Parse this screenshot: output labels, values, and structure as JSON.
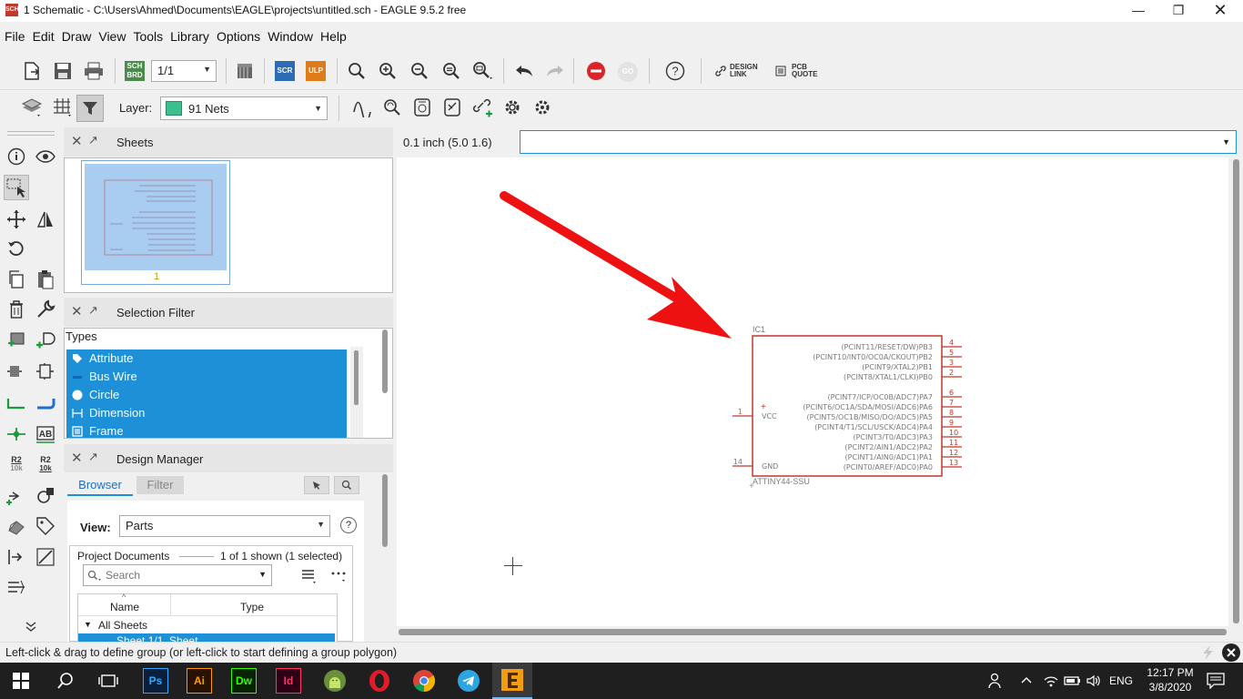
{
  "window": {
    "app_icon_text": "SCH",
    "title": "1 Schematic - C:\\Users\\Ahmed\\Documents\\EAGLE\\projects\\untitled.sch - EAGLE 9.5.2 free"
  },
  "menu": [
    "File",
    "Edit",
    "Draw",
    "View",
    "Tools",
    "Library",
    "Options",
    "Window",
    "Help"
  ],
  "toolbar1": {
    "sch_brd_top": "SCH",
    "sch_brd_bottom": "BRD",
    "sheet_select": "1/1",
    "scr_label": "SCR",
    "ulp_label": "ULP",
    "go_label": "GO",
    "design_link_1": "DESIGN",
    "design_link_2": "LINK",
    "pcb_quote_1": "PCB",
    "pcb_quote_2": "QUOTE"
  },
  "toolbar2": {
    "layer_label": "Layer:",
    "layer_value": "91 Nets",
    "layer_color": "#3cbf8f"
  },
  "lefttools": {
    "r2_a": "R2",
    "r2_a_val": "10k",
    "r2_b": "R2",
    "r2_b_val": "10k",
    "ab_label": "AB"
  },
  "panels": {
    "sheets": {
      "title": "Sheets",
      "thumb_label": "1"
    },
    "selection_filter": {
      "title": "Selection Filter",
      "types_header": "Types",
      "types": [
        "Attribute",
        "Bus Wire",
        "Circle",
        "Dimension",
        "Frame"
      ]
    },
    "design_manager": {
      "title": "Design Manager",
      "tab_browser": "Browser",
      "tab_filter": "Filter",
      "view_label": "View:",
      "view_value": "Parts",
      "project_docs": "Project Documents",
      "shown": "1 of 1 shown (1 selected)",
      "search_placeholder": "Search",
      "col_name": "Name",
      "col_type": "Type",
      "tree_root": "All Sheets",
      "tree_child": "Sheet 1/1, Sheet"
    }
  },
  "canvas": {
    "coord_readout": "0.1 inch (5.0 1.6)",
    "component": {
      "ref": "IC1",
      "value": "ATTINY44-SSU",
      "left_pins": [
        {
          "num": "1",
          "name": "VCC"
        },
        {
          "num": "14",
          "name": "GND"
        }
      ],
      "right_pins": [
        {
          "num": "4",
          "name": "(PCINT11/RESET/DW)PB3"
        },
        {
          "num": "5",
          "name": "(PCINT10/INT0/OC0A/CKOUT)PB2"
        },
        {
          "num": "3",
          "name": "(PCINT9/XTAL2)PB1"
        },
        {
          "num": "2",
          "name": "(PCINT8/XTAL1/CLKI)PB0"
        },
        {
          "num": "6",
          "name": "(PCINT7/ICP/OC0B/ADC7)PA7"
        },
        {
          "num": "7",
          "name": "(PCINT6/OC1A/SDA/MOSI/ADC6)PA6"
        },
        {
          "num": "8",
          "name": "(PCINT5/OC1B/MISO/DO/ADC5)PA5"
        },
        {
          "num": "9",
          "name": "(PCINT4/T1/SCL/USCK/ADC4)PA4"
        },
        {
          "num": "10",
          "name": "(PCINT3/T0/ADC3)PA3"
        },
        {
          "num": "11",
          "name": "(PCINT2/AIN1/ADC2)PA2"
        },
        {
          "num": "12",
          "name": "(PCINT1/AIN0/ADC1)PA1"
        },
        {
          "num": "13",
          "name": "(PCINT0/AREF/ADC0)PA0"
        }
      ]
    },
    "arrow_color": "#ee1111",
    "symbol_color": "#c0392b"
  },
  "status": {
    "message": "Left-click & drag to define group (or left-click to start defining a group polygon)"
  },
  "taskbar": {
    "apps": [
      "Ps",
      "Ai",
      "Dw",
      "Id"
    ],
    "lang": "ENG",
    "time": "12:17 PM",
    "date": "3/8/2020"
  }
}
